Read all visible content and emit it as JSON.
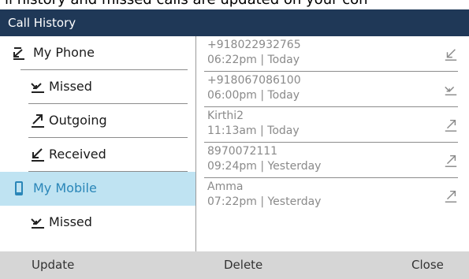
{
  "caption": {
    "text": "ll history and missed calls are updated on your con"
  },
  "header": {
    "title": "Call History"
  },
  "sidebar": {
    "items": [
      {
        "label": "My Phone",
        "icon": "phone-call-icon"
      },
      {
        "label": "Missed",
        "icon": "missed-call-icon"
      },
      {
        "label": "Outgoing",
        "icon": "outgoing-call-icon"
      },
      {
        "label": "Received",
        "icon": "received-call-icon"
      },
      {
        "label": "My Mobile",
        "icon": "mobile-phone-icon"
      },
      {
        "label": "Missed",
        "icon": "missed-call-icon"
      }
    ],
    "selected_index": 4
  },
  "calls": {
    "entries": [
      {
        "number": "+918022932765",
        "time": "06:22pm | Today",
        "direction": "received"
      },
      {
        "number": "+918067086100",
        "time": "06:00pm | Today",
        "direction": "missed"
      },
      {
        "number": "Kirthi2",
        "time": "11:13am | Today",
        "direction": "outgoing"
      },
      {
        "number": "8970072111",
        "time": "09:24pm | Yesterday",
        "direction": "outgoing"
      },
      {
        "number": "Amma",
        "time": "07:22pm | Yesterday",
        "direction": "outgoing"
      }
    ]
  },
  "softkeys": {
    "update": "Update",
    "delete": "Delete",
    "close": "Close"
  },
  "colors": {
    "title_bar": "#1f3857",
    "selected_bg": "#bfe3f2",
    "accent": "#2a86b8",
    "softkey_bg": "#d6d6d6"
  }
}
